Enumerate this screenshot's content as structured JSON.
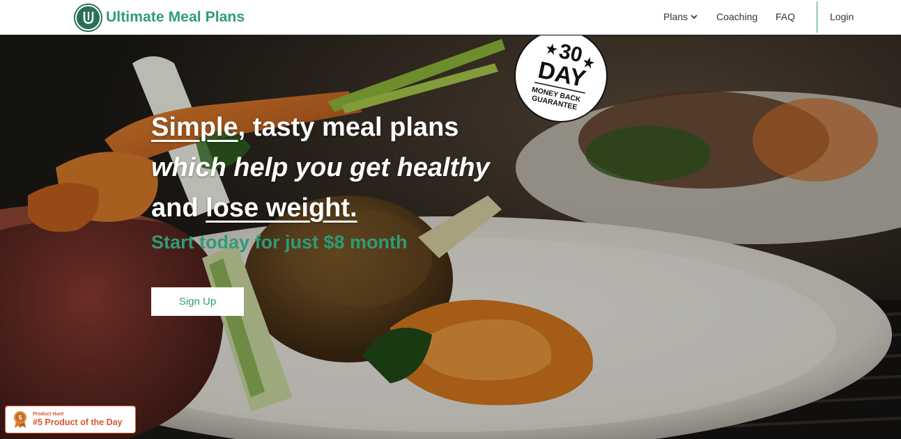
{
  "brand": {
    "name": "Ultimate Meal Plans",
    "accent": "#2f9c74",
    "logo_letter": "U"
  },
  "nav": {
    "plans": "Plans",
    "coaching": "Coaching",
    "faq": "FAQ",
    "login": "Login"
  },
  "hero": {
    "line1_underlined": "Simple",
    "line1_rest": ", tasty meal plans",
    "line2": "which help you get healthy",
    "line3_plain": "and ",
    "line3_underlined": "lose weight.",
    "subhead": "Start today for just $8 month",
    "cta": "Sign Up"
  },
  "guarantee_badge": {
    "number": "30",
    "unit": "DAY",
    "line1": "MONEY BACK",
    "line2": "GUARANTEE"
  },
  "producthunt": {
    "small": "Product Hunt",
    "big": "#5 Product of the Day",
    "rank": "5",
    "color": "#da552f"
  }
}
